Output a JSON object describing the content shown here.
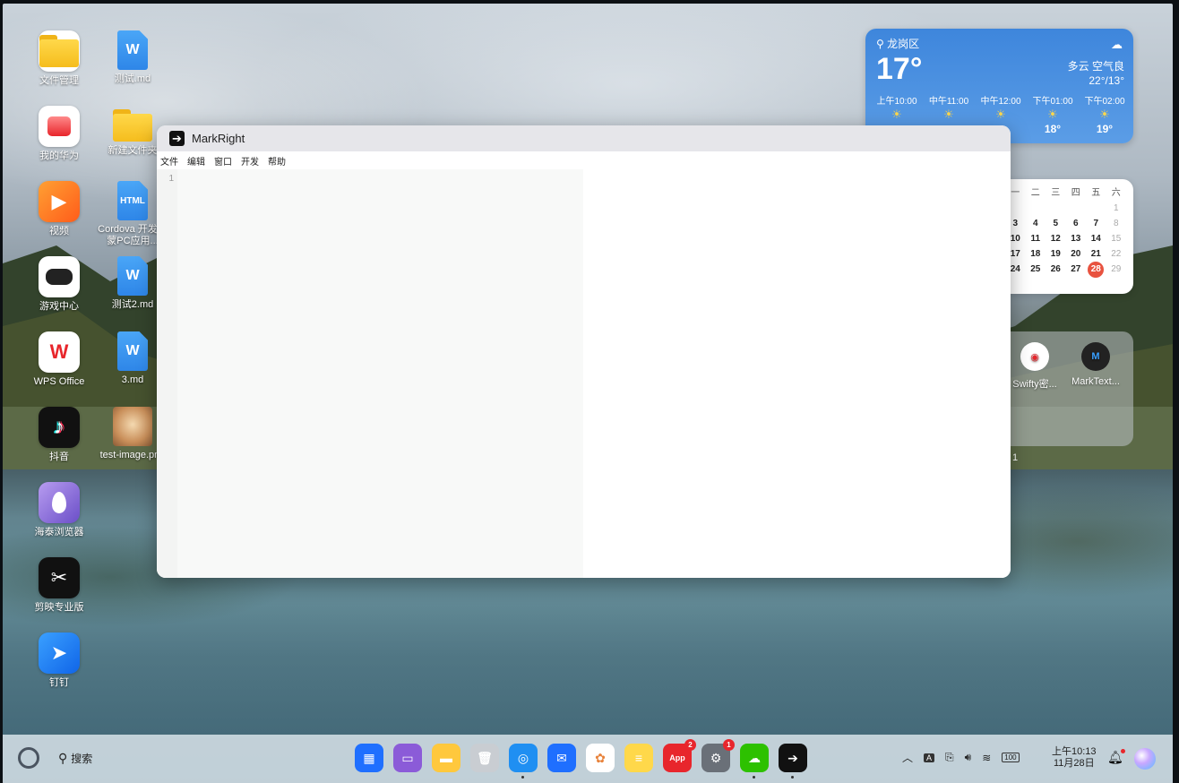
{
  "desktop": {
    "col1": [
      {
        "label": "文件管理",
        "icon": "folder-app-icon",
        "color": "#ffc83d"
      },
      {
        "label": "我的华为",
        "icon": "huawei-icon",
        "color": "#ffffff"
      },
      {
        "label": "视频",
        "icon": "video-play-icon",
        "color": "#ff7a1a"
      },
      {
        "label": "游戏中心",
        "icon": "gamepad-icon",
        "color": "#ffffff"
      },
      {
        "label": "WPS Office",
        "icon": "wps-icon",
        "color": "#ffffff"
      },
      {
        "label": "抖音",
        "icon": "tiktok-icon",
        "color": "#111111"
      },
      {
        "label": "海泰浏览器",
        "icon": "browser-icon",
        "color": "#8a6bd8"
      },
      {
        "label": "剪映专业版",
        "icon": "capcut-icon",
        "color": "#111111"
      },
      {
        "label": "钉钉",
        "icon": "dingtalk-icon",
        "color": "#1e8bff"
      }
    ],
    "col2": [
      {
        "label": "测试.md",
        "icon": "doc-icon",
        "mark": "W"
      },
      {
        "label": "新建文件夹",
        "icon": "folder-icon"
      },
      {
        "label": "Cordova 开发鸿蒙PC应用...",
        "icon": "html-file-icon",
        "mark": "HTML"
      },
      {
        "label": "测试2.md",
        "icon": "doc-icon",
        "mark": "W"
      },
      {
        "label": "3.md",
        "icon": "doc-icon",
        "mark": "W"
      },
      {
        "label": "test-image.png",
        "icon": "image-thumbnail-icon"
      }
    ]
  },
  "weather": {
    "location": "龙岗区",
    "temp": "17°",
    "condition": "多云  空气良",
    "range": "22°/13°",
    "hours": [
      {
        "time": "上午10:00",
        "temp": ""
      },
      {
        "time": "中午11:00",
        "temp": ""
      },
      {
        "time": "中午12:00",
        "temp": ""
      },
      {
        "time": "下午01:00",
        "temp": "18°"
      },
      {
        "time": "下午02:00",
        "temp": "19°"
      }
    ]
  },
  "calendar": {
    "headers": [
      "一",
      "二",
      "三",
      "四",
      "五",
      "六"
    ],
    "rows": [
      [
        "",
        "",
        "",
        "",
        "",
        "1"
      ],
      [
        "3",
        "4",
        "5",
        "6",
        "7",
        "8"
      ],
      [
        "10",
        "11",
        "12",
        "13",
        "14",
        "15"
      ],
      [
        "17",
        "18",
        "19",
        "20",
        "21",
        "22"
      ],
      [
        "24",
        "25",
        "26",
        "27",
        "28",
        "29"
      ]
    ],
    "today": "28"
  },
  "app_folder": {
    "apps": [
      {
        "label": "Swifty密..."
      },
      {
        "label": "MarkText..."
      }
    ],
    "page": "1"
  },
  "window": {
    "title": "MarkRight",
    "menu": [
      "文件",
      "编辑",
      "窗口",
      "开发",
      "帮助"
    ],
    "line_number": "1"
  },
  "taskbar": {
    "search_label": "搜索",
    "dock": [
      {
        "name": "app-center-icon",
        "color": "#1f6fff",
        "glyph": "▦"
      },
      {
        "name": "multitask-icon",
        "color": "#8b5bd8",
        "glyph": "▭"
      },
      {
        "name": "files-icon",
        "color": "#ffc83d",
        "glyph": "▬"
      },
      {
        "name": "trash-icon",
        "color": "#c9cdd2",
        "glyph": "🗑"
      },
      {
        "name": "browser-icon",
        "color": "#1f8ff2",
        "glyph": "◎",
        "running": true
      },
      {
        "name": "mail-icon",
        "color": "#1f6fff",
        "glyph": "✉"
      },
      {
        "name": "gallery-icon",
        "color": "#ffffff",
        "glyph": "✿"
      },
      {
        "name": "notes-icon",
        "color": "#ffd84a",
        "glyph": "≡"
      },
      {
        "name": "app-gallery-icon",
        "color": "#e8262c",
        "glyph": "App",
        "badge": "2"
      },
      {
        "name": "settings-icon",
        "color": "#6a7078",
        "glyph": "⚙",
        "badge": "1"
      },
      {
        "name": "wechat-icon",
        "color": "#2dc100",
        "glyph": "☁",
        "running": true
      },
      {
        "name": "markright-icon",
        "color": "#111111",
        "glyph": "➔",
        "running": true
      }
    ],
    "time": "上午10:13",
    "date": "11月28日",
    "battery": "100"
  }
}
